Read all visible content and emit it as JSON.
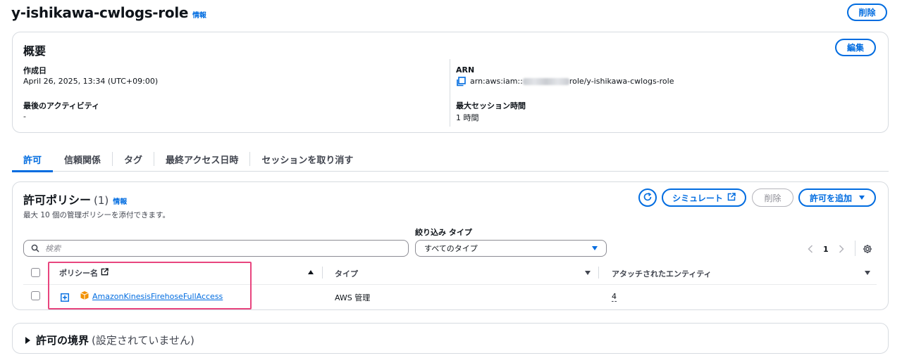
{
  "header": {
    "title": "y-ishikawa-cwlogs-role",
    "info": "情報",
    "delete_label": "削除"
  },
  "summary": {
    "heading": "概要",
    "edit_label": "編集",
    "created_label": "作成日",
    "created_value": "April 26, 2025, 13:34 (UTC+09:00)",
    "last_activity_label": "最後のアクティビティ",
    "last_activity_value": "-",
    "arn_label": "ARN",
    "arn_prefix": "arn:aws:iam::",
    "arn_suffix": "role/y-ishikawa-cwlogs-role",
    "session_label": "最大セッション時間",
    "session_value": "1 時間"
  },
  "tabs": [
    {
      "label": "許可",
      "active": true
    },
    {
      "label": "信頼関係",
      "active": false
    },
    {
      "label": "タグ",
      "active": false
    },
    {
      "label": "最終アクセス日時",
      "active": false
    },
    {
      "label": "セッションを取り消す",
      "active": false
    }
  ],
  "policies": {
    "heading": "許可ポリシー",
    "count": "(1)",
    "info": "情報",
    "description": "最大 10 個の管理ポリシーを添付できます。",
    "simulate_label": "シミュレート",
    "remove_label": "削除",
    "add_label": "許可を追加",
    "search_placeholder": "検索",
    "filter_label": "絞り込み タイプ",
    "filter_value": "すべてのタイプ",
    "page_number": "1",
    "columns": {
      "name": "ポリシー名",
      "type": "タイプ",
      "entities": "アタッチされたエンティティ"
    },
    "rows": [
      {
        "name": "AmazonKinesisFirehoseFullAccess",
        "type": "AWS 管理",
        "entities": "4"
      }
    ]
  },
  "boundary": {
    "heading": "許可の境界",
    "status": "(設定されていません)"
  },
  "colors": {
    "accent": "#006ce0",
    "highlight": "#e8457e",
    "aws_orange": "#f29100"
  }
}
